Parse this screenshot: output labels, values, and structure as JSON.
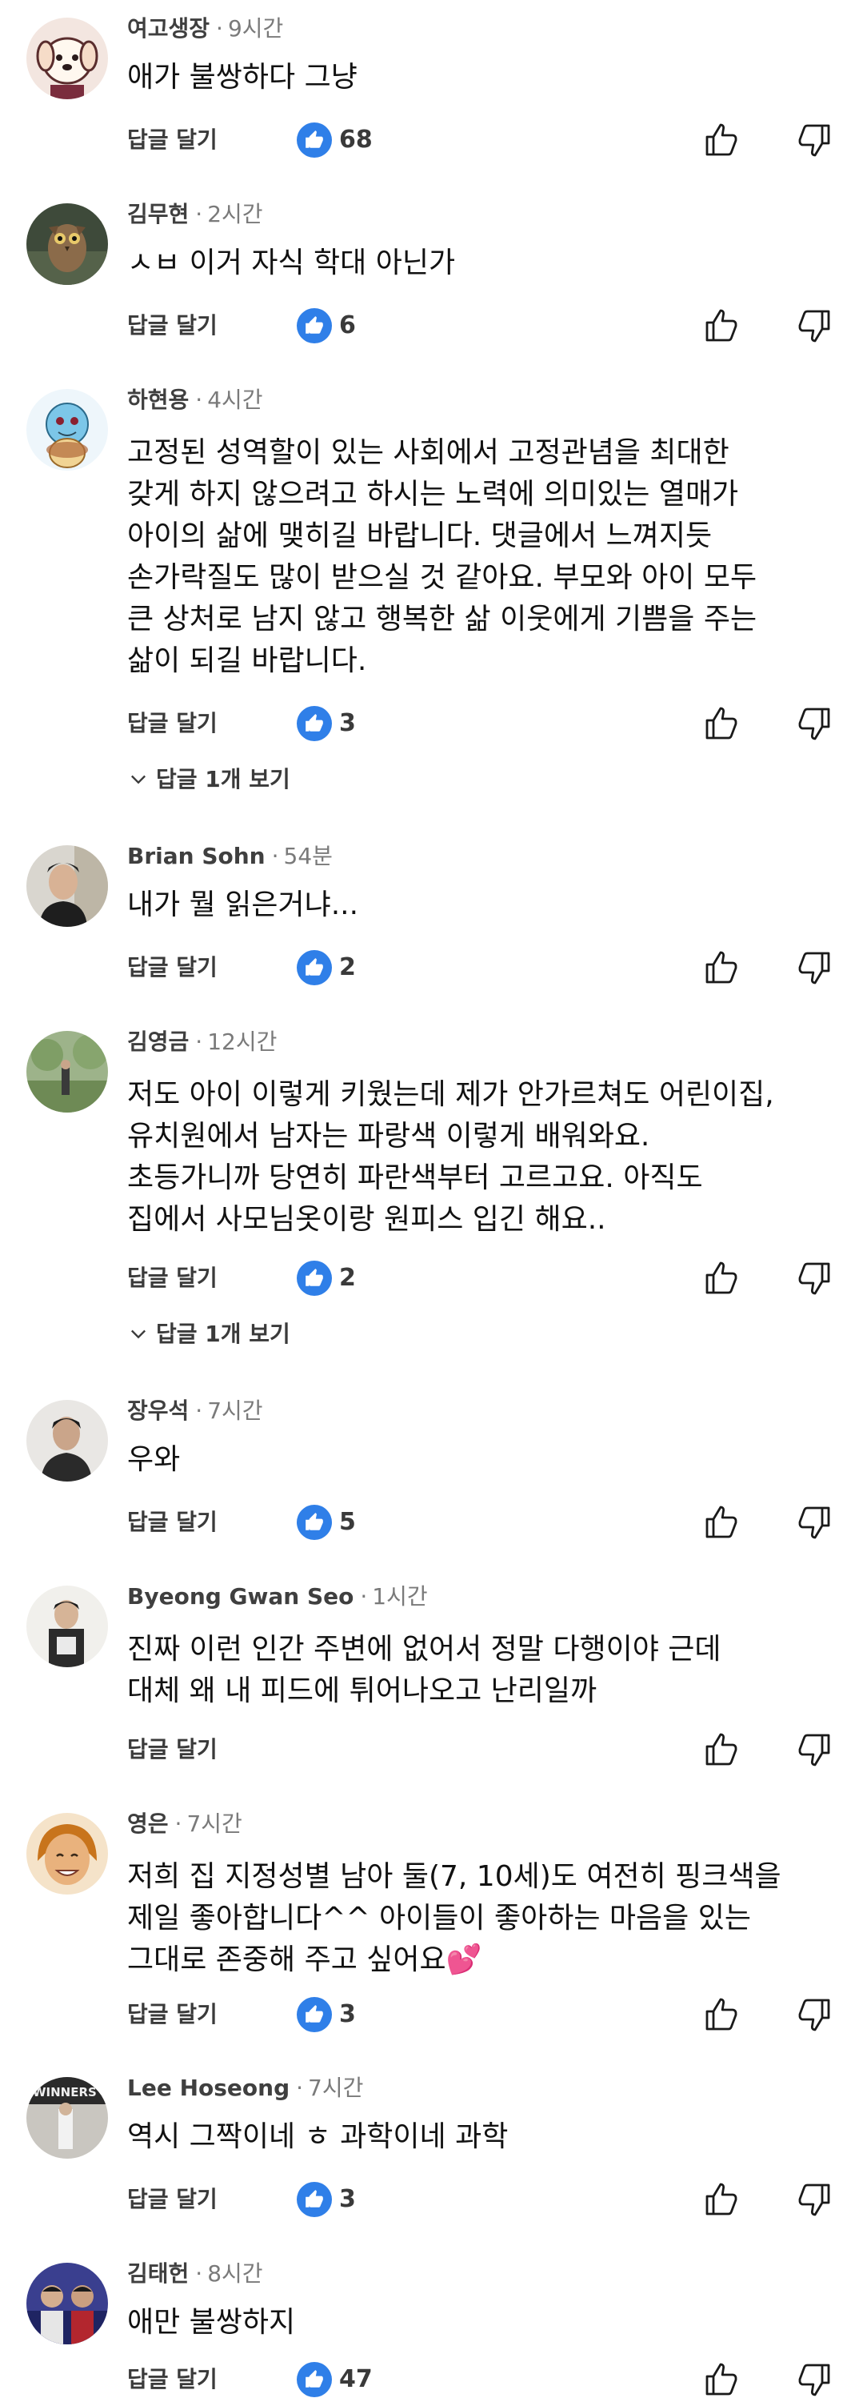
{
  "ui": {
    "reply_label": "답글 달기"
  },
  "comments": [
    {
      "author": "여고생장",
      "time": "9시간",
      "text": [
        "애가 불쌍하다 그냥"
      ],
      "likes": "68",
      "replies_label": ""
    },
    {
      "author": "김무현",
      "time": "2시간",
      "text": [
        "ㅅㅂ 이거 자식 학대 아닌가"
      ],
      "likes": "6",
      "replies_label": ""
    },
    {
      "author": "하현용",
      "time": "4시간",
      "text": [
        "고정된 성역할이 있는 사회에서 고정관념을 최대한",
        "갖게 하지 않으려고 하시는 노력에 의미있는 열매가",
        "아이의 삶에 맺히길 바랍니다. 댓글에서 느껴지듯",
        "손가락질도 많이 받으실 것 같아요. 부모와 아이 모두",
        "큰 상처로 남지 않고 행복한 삶 이웃에게 기쁨을 주는",
        "삶이 되길 바랍니다."
      ],
      "likes": "3",
      "replies_label": "답글 1개 보기"
    },
    {
      "author": "Brian Sohn",
      "time": "54분",
      "text": [
        "내가 뭘 읽은거냐..."
      ],
      "likes": "2",
      "replies_label": ""
    },
    {
      "author": "김영금",
      "time": "12시간",
      "text": [
        "저도 아이 이렇게 키웠는데 제가 안가르쳐도 어린이집,",
        "유치원에서 남자는 파랑색 이렇게 배워와요.",
        "초등가니까 당연히 파란색부터 고르고요. 아직도",
        "집에서 사모님옷이랑 원피스 입긴 해요.."
      ],
      "likes": "2",
      "replies_label": "답글 1개 보기"
    },
    {
      "author": "장우석",
      "time": "7시간",
      "text": [
        "우와"
      ],
      "likes": "5",
      "replies_label": ""
    },
    {
      "author": "Byeong Gwan Seo",
      "time": "1시간",
      "text": [
        "진짜 이런 인간 주변에 없어서 정말 다행이야 근데",
        "대체 왜 내 피드에 튀어나오고 난리일까"
      ],
      "likes": "",
      "replies_label": ""
    },
    {
      "author": "영은",
      "time": "7시간",
      "text": [
        "저희 집 지정성별 남아 둘(7, 10세)도 여전히 핑크색을",
        "제일 좋아합니다^^ 아이들이 좋아하는 마음을 있는",
        "그대로 존중해 주고 싶어요💕"
      ],
      "likes": "3",
      "replies_label": ""
    },
    {
      "author": "Lee Hoseong",
      "time": "7시간",
      "text": [
        "역시 그짝이네 ㅎ 과학이네 과학"
      ],
      "likes": "3",
      "replies_label": ""
    },
    {
      "author": "김태헌",
      "time": "8시간",
      "text": [
        "애만 불쌍하지"
      ],
      "likes": "47",
      "replies_label": ""
    }
  ],
  "icons": {
    "like_badge": "thumbs-up-filled-icon",
    "like_button": "thumbs-up-outline-icon",
    "dislike_button": "thumbs-down-outline-icon",
    "expand": "chevron-down-icon"
  },
  "colors": {
    "like_badge": "#2f7fe8",
    "secondary_text": "#7a7a7a",
    "primary_text": "#111111"
  }
}
